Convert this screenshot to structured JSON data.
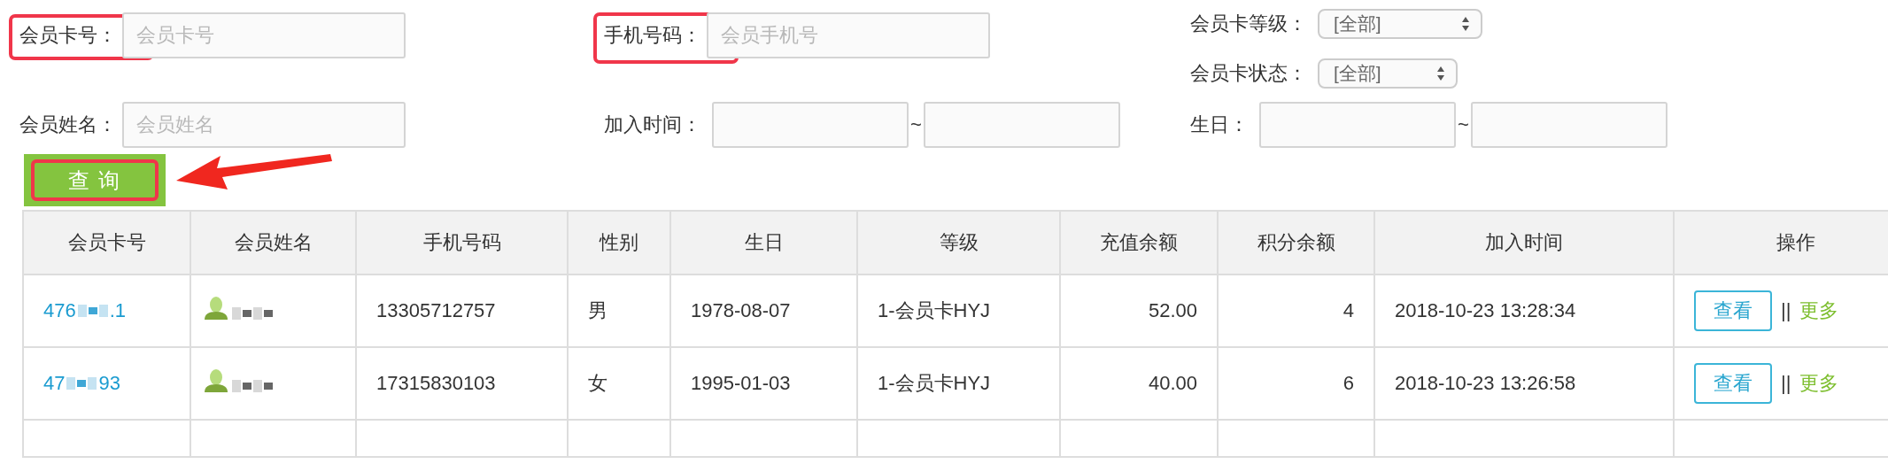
{
  "filters": [
    {
      "kind": "text",
      "label": "会员卡号：",
      "placeholder": "会员卡号",
      "highlighted": true
    },
    {
      "kind": "text",
      "label": "手机号码：",
      "placeholder": "会员手机号",
      "highlighted": true
    },
    {
      "kind": "selects",
      "items": [
        {
          "label": "会员卡等级：",
          "value": "[全部]"
        },
        {
          "label": "会员卡状态：",
          "value": "[全部]"
        }
      ]
    },
    {
      "kind": "text",
      "label": "会员姓名：",
      "placeholder": "会员姓名"
    },
    {
      "kind": "range",
      "label": "加入时间：",
      "separator": "~"
    },
    {
      "kind": "range",
      "label": "生日：",
      "separator": "~"
    }
  ],
  "query_button": {
    "label": "查 询",
    "highlighted": true,
    "arrow": true
  },
  "table": {
    "columns": [
      "会员卡号",
      "会员姓名",
      "手机号码",
      "性别",
      "生日",
      "等级",
      "充值余额",
      "积分余额",
      "加入时间",
      "操作"
    ],
    "rows": [
      {
        "card_start": "476",
        "card_end": ".1",
        "phone": "13305712757",
        "gender": "男",
        "birthday": "1978-08-07",
        "level": "1-会员卡HYJ",
        "balance": "52.00",
        "points": "4",
        "joined": "2018-10-23 13:28:34",
        "view": "查看",
        "sep": "||",
        "more": "更多"
      },
      {
        "card_start": "47",
        "card_end": "93",
        "phone": "17315830103",
        "gender": "女",
        "birthday": "1995-01-03",
        "level": "1-会员卡HYJ",
        "balance": "40.00",
        "points": "6",
        "joined": "2018-10-23 13:26:58",
        "view": "查看",
        "sep": "||",
        "more": "更多"
      }
    ]
  }
}
